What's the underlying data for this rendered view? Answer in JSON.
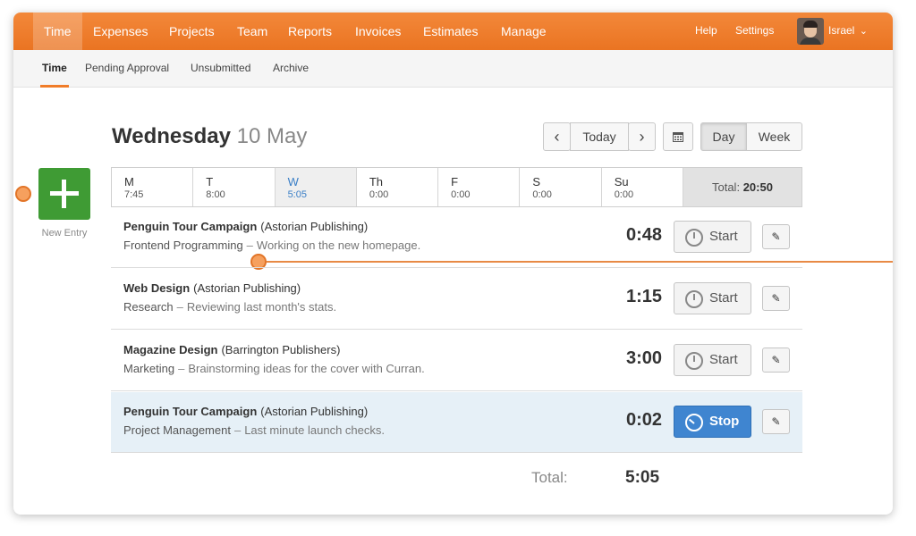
{
  "topnav": {
    "items": [
      "Time",
      "Expenses",
      "Projects",
      "Team",
      "Reports",
      "Invoices",
      "Estimates",
      "Manage"
    ],
    "help": "Help",
    "settings": "Settings",
    "user": "Israel",
    "user_chevron": "⌄"
  },
  "subnav": {
    "tabs": [
      "Time",
      "Pending Approval",
      "Unsubmitted",
      "Archive"
    ]
  },
  "new_entry": {
    "label": "New Entry",
    "icon": "plus-icon"
  },
  "heading": {
    "day": "Wednesday",
    "date": "10 May"
  },
  "controls": {
    "prev": "‹",
    "today": "Today",
    "next": "›",
    "calendar_icon": "calendar-icon",
    "day": "Day",
    "week": "Week"
  },
  "week": {
    "days": [
      {
        "name": "M",
        "value": "7:45"
      },
      {
        "name": "T",
        "value": "8:00"
      },
      {
        "name": "W",
        "value": "5:05"
      },
      {
        "name": "Th",
        "value": "0:00"
      },
      {
        "name": "F",
        "value": "0:00"
      },
      {
        "name": "S",
        "value": "0:00"
      },
      {
        "name": "Su",
        "value": "0:00"
      }
    ],
    "total_label": "Total:",
    "total_value": "20:50"
  },
  "entries": [
    {
      "project": "Penguin Tour Campaign",
      "client": "(Astorian Publishing)",
      "task": "Frontend Programming",
      "sep": "–",
      "notes": "Working on the new homepage.",
      "duration": "0:48",
      "button": "Start",
      "edit_icon": "pencil-icon"
    },
    {
      "project": "Web Design",
      "client": "(Astorian Publishing)",
      "task": "Research",
      "sep": "–",
      "notes": "Reviewing last month's stats.",
      "duration": "1:15",
      "button": "Start",
      "edit_icon": "pencil-icon"
    },
    {
      "project": "Magazine Design",
      "client": "(Barrington Publishers)",
      "task": "Marketing",
      "sep": "–",
      "notes": "Brainstorming ideas for the cover with Curran.",
      "duration": "3:00",
      "button": "Start",
      "edit_icon": "pencil-icon"
    },
    {
      "project": "Penguin Tour Campaign",
      "client": "(Astorian Publishing)",
      "task": "Project Management",
      "sep": "–",
      "notes": "Last minute launch checks.",
      "duration": "0:02",
      "button": "Stop",
      "edit_icon": "pencil-icon"
    }
  ],
  "footer": {
    "total_label": "Total:",
    "total_value": "5:05"
  },
  "colors": {
    "brand": "#f07c28",
    "new_entry": "#3f9b34",
    "stop": "#3f85d0",
    "current_day": "#3a7fc7"
  }
}
